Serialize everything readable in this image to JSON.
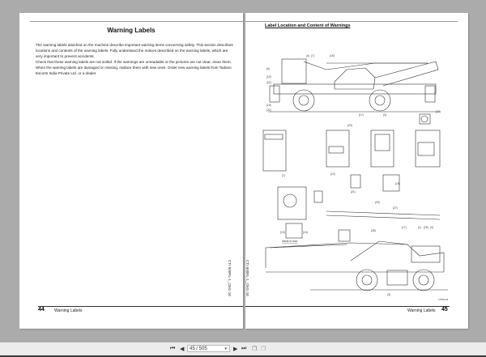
{
  "left_page": {
    "title": "Warning Labels",
    "paragraphs": [
      "The warning labels attached on the machine describe important warning items concerning safety. This section describes locations and contents of the warning labels. Fully understand the notices described on the warning labels, which are very important to prevent accidents.",
      "Check that these warning labels are not soiled. If the warnings are unreadable or the pictures are not clear, clean them.",
      "When the warning labels are damaged or missing, replace them with new ones. Order new warning labels from Tadano Escorts India Private Ltd. or a dealer."
    ],
    "page_number": "44",
    "footer_text": "Warning Labels",
    "side_code": "CTI-500RL-1_OM1-1E"
  },
  "right_page": {
    "title": "Label Location and Content of Warnings",
    "callouts": [
      "(4)",
      "(7)",
      "(15)",
      "(6)",
      "(12)",
      "(22)",
      "(15)",
      "(22)",
      "(17)",
      "(3)",
      "(10)",
      "(23)",
      "(7)",
      "(12)",
      "(21)",
      "(19)",
      "(20)",
      "(27)",
      "(13)",
      "(14)",
      "(28)",
      "(17)",
      "(1)",
      "(25)",
      "(4)",
      "(3)"
    ],
    "inside_door_caption": "Inside of door",
    "figure_code": "CTI500-06",
    "page_number": "45",
    "footer_text": "Warning Labels",
    "side_code": "CTI-500RL-1_OM1-1E"
  },
  "toolbar": {
    "first_icon": "first-page-icon",
    "prev_icon": "prev-page-icon",
    "page_value": "45 / 505",
    "next_icon": "next-page-icon",
    "last_icon": "last-page-icon"
  }
}
